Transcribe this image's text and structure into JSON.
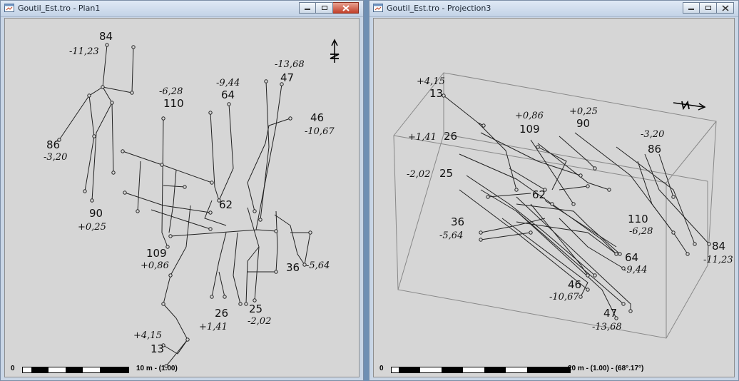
{
  "windows": {
    "plan": {
      "title": "Goutil_Est.tro - Plan1",
      "scale_zero": "0",
      "scale_label": "10 m - (1.00)",
      "north_icon": "north-arrow-icon",
      "labels": [
        {
          "num": "84",
          "depth": "-11,23"
        },
        {
          "num": "47",
          "depth": "-13,68"
        },
        {
          "num": "64",
          "depth": "-9,44"
        },
        {
          "num": "110",
          "depth": "-6,28"
        },
        {
          "num": "46",
          "depth": "-10,67"
        },
        {
          "num": "86",
          "depth": "-3,20"
        },
        {
          "num": "62",
          "depth": ""
        },
        {
          "num": "90",
          "depth": "+0,25"
        },
        {
          "num": "109",
          "depth": "+0,86"
        },
        {
          "num": "36",
          "depth": "-5,64"
        },
        {
          "num": "26",
          "depth": "+1,41"
        },
        {
          "num": "25",
          "depth": "-2,02"
        },
        {
          "num": "13",
          "depth": "+4,15"
        }
      ]
    },
    "projection": {
      "title": "Goutil_Est.tro - Projection3",
      "scale_zero": "0",
      "scale_label": "20 m - (1.00) - (68°.17°)",
      "north_icon": "north-arrow-icon",
      "labels": [
        {
          "num": "13",
          "depth": "+4,15"
        },
        {
          "num": "109",
          "depth": "+0,86"
        },
        {
          "num": "90",
          "depth": "+0,25"
        },
        {
          "num": "26",
          "depth": "+1,41"
        },
        {
          "num": "86",
          "depth": "-3,20"
        },
        {
          "num": "25",
          "depth": "-2,02"
        },
        {
          "num": "62",
          "depth": ""
        },
        {
          "num": "36",
          "depth": "-5,64"
        },
        {
          "num": "110",
          "depth": "-6,28"
        },
        {
          "num": "84",
          "depth": "-11,23"
        },
        {
          "num": "64",
          "depth": "-9,44"
        },
        {
          "num": "46",
          "depth": "-10,67"
        },
        {
          "num": "47",
          "depth": "-13,68"
        }
      ]
    }
  },
  "colors": {
    "title_bg": "#c9d6e6",
    "canvas_bg": "#d6d6d6",
    "line": "#222222",
    "close_active": "#c2402a"
  }
}
